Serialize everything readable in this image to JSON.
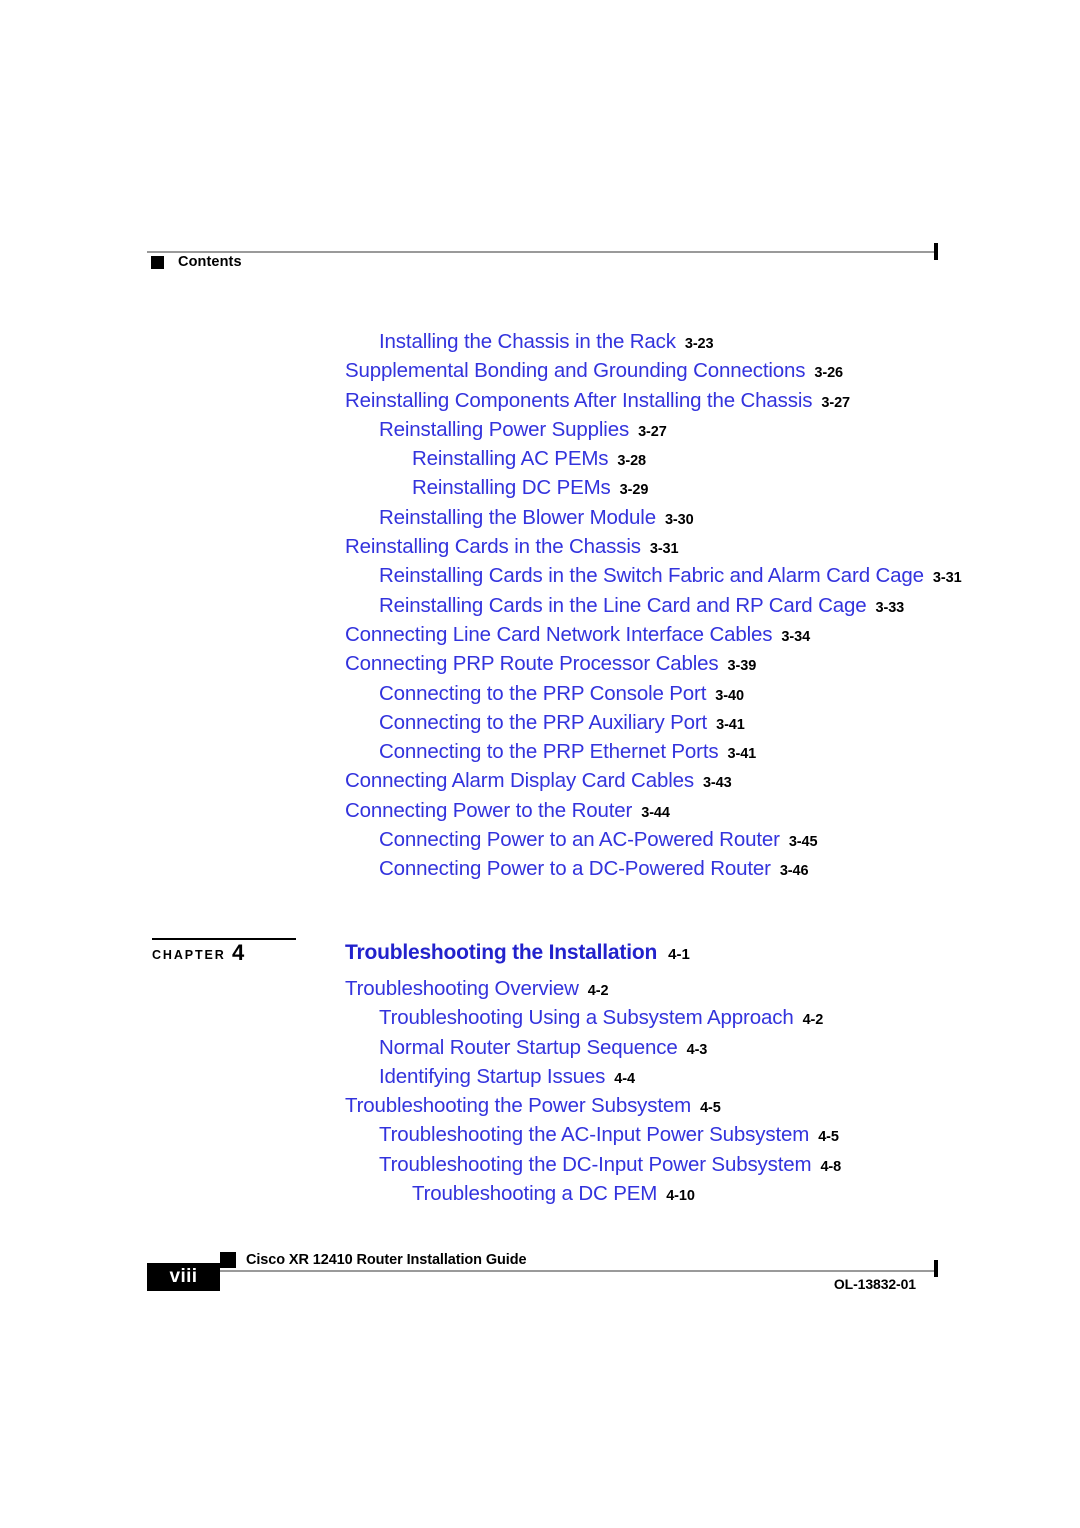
{
  "header": {
    "bullet_icon": "black-square-icon",
    "label": "Contents"
  },
  "toc_group_1": {
    "entries": [
      {
        "title": "Installing the Chassis in the Rack",
        "page": "3-23",
        "level": 2
      },
      {
        "title": "Supplemental Bonding and Grounding Connections",
        "page": "3-26",
        "level": 1
      },
      {
        "title": "Reinstalling Components After Installing the Chassis",
        "page": "3-27",
        "level": 1
      },
      {
        "title": "Reinstalling Power Supplies",
        "page": "3-27",
        "level": 2
      },
      {
        "title": "Reinstalling AC PEMs",
        "page": "3-28",
        "level": 3
      },
      {
        "title": "Reinstalling DC PEMs",
        "page": "3-29",
        "level": 3
      },
      {
        "title": "Reinstalling the Blower Module",
        "page": "3-30",
        "level": 2
      },
      {
        "title": "Reinstalling Cards in the Chassis",
        "page": "3-31",
        "level": 1
      },
      {
        "title": "Reinstalling Cards in the Switch Fabric and Alarm Card Cage",
        "page": "3-31",
        "level": 2
      },
      {
        "title": "Reinstalling Cards in the Line Card and RP Card Cage",
        "page": "3-33",
        "level": 2
      },
      {
        "title": "Connecting Line Card Network Interface Cables",
        "page": "3-34",
        "level": 1
      },
      {
        "title": "Connecting PRP Route Processor Cables",
        "page": "3-39",
        "level": 1
      },
      {
        "title": "Connecting to the PRP Console Port",
        "page": "3-40",
        "level": 2
      },
      {
        "title": "Connecting to the PRP Auxiliary Port",
        "page": "3-41",
        "level": 2
      },
      {
        "title": "Connecting to the PRP Ethernet Ports",
        "page": "3-41",
        "level": 2
      },
      {
        "title": "Connecting Alarm Display Card Cables",
        "page": "3-43",
        "level": 1
      },
      {
        "title": "Connecting Power to the Router",
        "page": "3-44",
        "level": 1
      },
      {
        "title": "Connecting Power to an AC-Powered Router",
        "page": "3-45",
        "level": 2
      },
      {
        "title": "Connecting Power to a DC-Powered Router",
        "page": "3-46",
        "level": 2
      }
    ]
  },
  "chapter": {
    "word": "CHAPTER",
    "number": "4",
    "title": "Troubleshooting the Installation",
    "page": "4-1"
  },
  "toc_group_2": {
    "entries": [
      {
        "title": "Troubleshooting Overview",
        "page": "4-2",
        "level": 1
      },
      {
        "title": "Troubleshooting Using a Subsystem Approach",
        "page": "4-2",
        "level": 2
      },
      {
        "title": "Normal Router Startup Sequence",
        "page": "4-3",
        "level": 2
      },
      {
        "title": "Identifying Startup Issues",
        "page": "4-4",
        "level": 2
      },
      {
        "title": "Troubleshooting the Power Subsystem",
        "page": "4-5",
        "level": 1
      },
      {
        "title": "Troubleshooting the AC-Input Power Subsystem",
        "page": "4-5",
        "level": 2
      },
      {
        "title": "Troubleshooting the DC-Input Power Subsystem",
        "page": "4-8",
        "level": 2
      },
      {
        "title": "Troubleshooting a DC PEM",
        "page": "4-10",
        "level": 3
      }
    ]
  },
  "footer": {
    "page_number": "viii",
    "bullet_icon": "black-square-icon",
    "document_title": "Cisco XR 12410 Router Installation Guide",
    "document_id": "OL-13832-01"
  },
  "colors": {
    "toc_link_blue": "#3333dd",
    "chapter_title_blue": "#2222cc",
    "rule_gray": "#9a9a9a",
    "text_black": "#000000"
  }
}
